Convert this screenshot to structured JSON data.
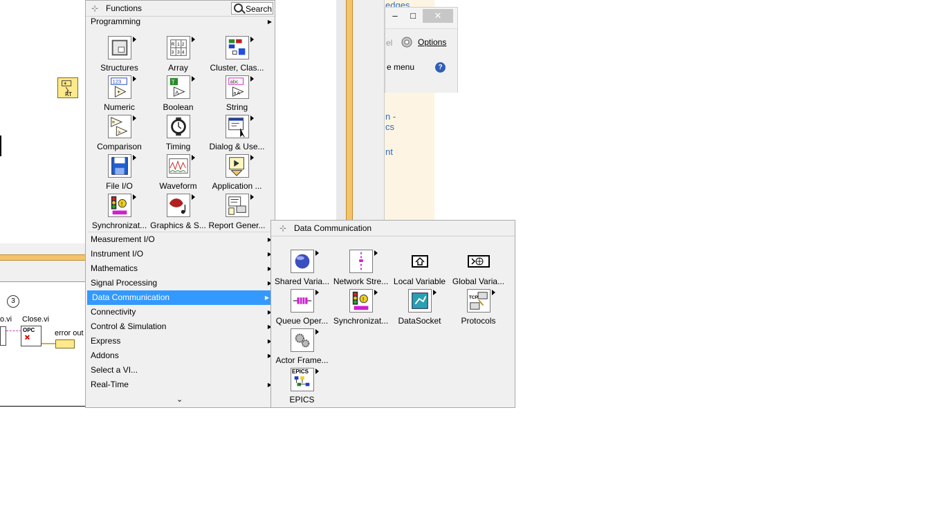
{
  "background": {
    "diagram": {
      "node_rt_label": "RT",
      "frame_number": "3",
      "vi_labels": [
        "o.vi",
        "Close.vi"
      ],
      "opc_label": "OPC",
      "error_out_label": "error out"
    },
    "help_panel": {
      "link_fragment_top": "edges",
      "link_fragment_1": "n -",
      "link_fragment_2": "cs",
      "link_fragment_3": "nt",
      "window_controls": {
        "minimize": "–",
        "maximize": "□",
        "close": "✕"
      },
      "partial_label": "el",
      "options_label": "Options",
      "menu_label": "e menu",
      "help_icon": "?"
    }
  },
  "functions_palette": {
    "title": "Functions",
    "search_label": "Search",
    "top_category": "Programming",
    "tiles": [
      {
        "label": "Structures",
        "icon": "structures-icon"
      },
      {
        "label": "Array",
        "icon": "array-icon"
      },
      {
        "label": "Cluster, Clas...",
        "icon": "cluster-icon"
      },
      {
        "label": "Numeric",
        "icon": "numeric-icon"
      },
      {
        "label": "Boolean",
        "icon": "boolean-icon"
      },
      {
        "label": "String",
        "icon": "string-icon"
      },
      {
        "label": "Comparison",
        "icon": "comparison-icon"
      },
      {
        "label": "Timing",
        "icon": "timing-icon"
      },
      {
        "label": "Dialog & Use...",
        "icon": "dialog-icon"
      },
      {
        "label": "File I/O",
        "icon": "file-io-icon"
      },
      {
        "label": "Waveform",
        "icon": "waveform-icon"
      },
      {
        "label": "Application ...",
        "icon": "application-icon"
      },
      {
        "label": "Synchronizat...",
        "icon": "synchronization-icon"
      },
      {
        "label": "Graphics & S...",
        "icon": "graphics-sound-icon"
      },
      {
        "label": "Report Gener...",
        "icon": "report-generation-icon"
      }
    ],
    "categories": [
      {
        "label": "Measurement I/O",
        "selected": false
      },
      {
        "label": "Instrument I/O",
        "selected": false
      },
      {
        "label": "Mathematics",
        "selected": false
      },
      {
        "label": "Signal Processing",
        "selected": false
      },
      {
        "label": "Data Communication",
        "selected": true
      },
      {
        "label": "Connectivity",
        "selected": false
      },
      {
        "label": "Control & Simulation",
        "selected": false
      },
      {
        "label": "Express",
        "selected": false
      },
      {
        "label": "Addons",
        "selected": false
      },
      {
        "label": "Select a VI...",
        "selected": false
      },
      {
        "label": "Real-Time",
        "selected": false
      }
    ],
    "more_chevron": "⌄"
  },
  "data_communication_palette": {
    "title": "Data Communication",
    "tiles": [
      {
        "label": "Shared Varia...",
        "icon": "shared-variable-icon"
      },
      {
        "label": "Network Stre...",
        "icon": "network-streams-icon"
      },
      {
        "label": "Local Variable",
        "icon": "local-variable-icon"
      },
      {
        "label": "Global Varia...",
        "icon": "global-variable-icon"
      },
      {
        "label": "Queue Oper...",
        "icon": "queue-operations-icon"
      },
      {
        "label": "Synchronizat...",
        "icon": "synchronization-icon"
      },
      {
        "label": "DataSocket",
        "icon": "datasocket-icon"
      },
      {
        "label": "Protocols",
        "icon": "protocols-icon"
      },
      {
        "label": "Actor Frame...",
        "icon": "actor-framework-icon"
      },
      {
        "label": "EPICS",
        "icon": "epics-icon"
      }
    ],
    "epics_badge": "EPICS",
    "tcp_badge": "TCP"
  },
  "colors": {
    "selection": "#3399ff",
    "palette_bg": "#f0f0f0",
    "link": "#2e6ebf",
    "stripe": "#f5c46a"
  }
}
